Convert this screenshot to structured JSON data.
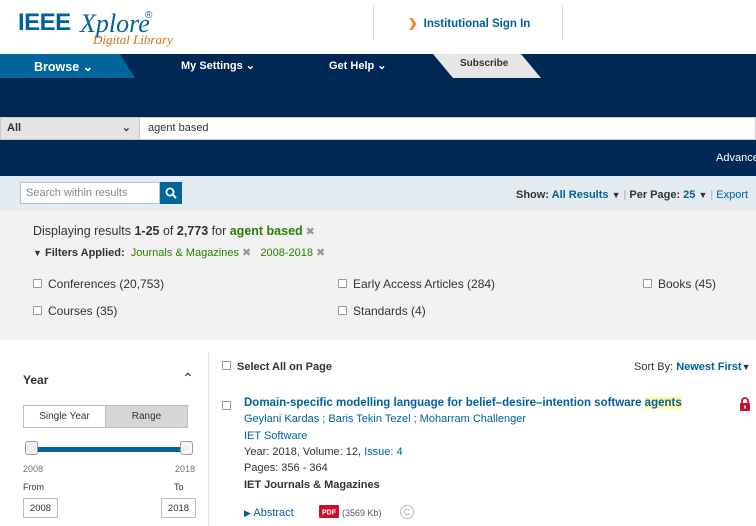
{
  "header": {
    "logo_ieee": "IEEE",
    "logo_xplore": "Xplore",
    "logo_reg": "®",
    "logo_dl": "Digital Library",
    "institutional_sign_in": "Institutional Sign In"
  },
  "nav": {
    "browse": "Browse",
    "my_settings": "My Settings",
    "get_help": "Get Help",
    "subscribe": "Subscribe"
  },
  "search": {
    "scope": "All",
    "query": "agent based",
    "advanced": "Advanced"
  },
  "within": {
    "placeholder": "Search within results",
    "show_label": "Show:",
    "show_value": "All Results",
    "per_page_label": "Per Page:",
    "per_page_value": "25",
    "export": "Export"
  },
  "summary": {
    "displaying_prefix": "Displaying results",
    "range": "1-25",
    "of": "of",
    "total": "2,773",
    "for": "for",
    "query": "agent based",
    "filters_label": "Filters Applied:",
    "filters": [
      "Journals & Magazines",
      "2008-2018"
    ]
  },
  "facets": [
    {
      "label": "Conferences (20,753)"
    },
    {
      "label": "Early Access Articles (284)"
    },
    {
      "label": "Books (45)"
    },
    {
      "label": "Courses (35)"
    },
    {
      "label": "Standards (4)"
    }
  ],
  "sidebar": {
    "year_title": "Year",
    "toggle_single": "Single Year",
    "toggle_range": "Range",
    "slider_min": "2008",
    "slider_max": "2018",
    "from_label": "From",
    "to_label": "To",
    "from_value": "2008",
    "to_value": "2018"
  },
  "results_header": {
    "select_all": "Select All on Page",
    "sort_by_label": "Sort By:",
    "sort_by_value": "Newest First"
  },
  "results": [
    {
      "title_main": "Domain-specific modelling language for belief–desire–intention software ",
      "title_highlight": "agents",
      "authors": "Geylani Kardas ; Baris Tekin Tezel ; Moharram Challenger",
      "publication": "IET Software",
      "year_volume": "Year: 2018, Volume: 12, ",
      "issue": "Issue: 4",
      "pages": "Pages: 356 - 364",
      "pub_type": "IET Journals & Magazines",
      "abstract": "Abstract",
      "pdf_size": "(3569 Kb)"
    }
  ]
}
